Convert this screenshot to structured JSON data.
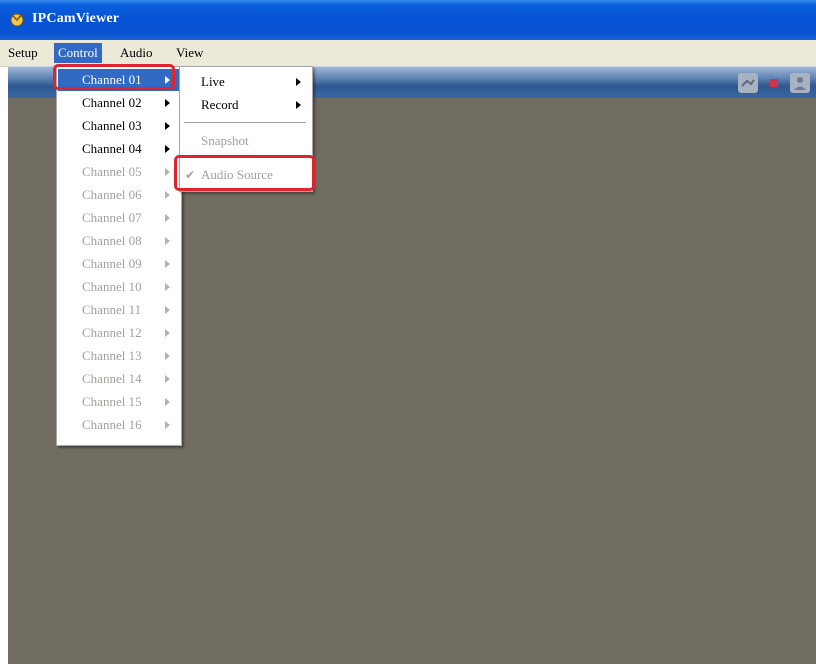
{
  "window": {
    "title": "IPCamViewer"
  },
  "menubar": {
    "items": [
      {
        "label": "Setup"
      },
      {
        "label": "Control"
      },
      {
        "label": "Audio"
      },
      {
        "label": "View"
      }
    ]
  },
  "control_menu": {
    "channels": [
      {
        "label": "Channel 01",
        "enabled": true,
        "selected": true
      },
      {
        "label": "Channel 02",
        "enabled": true
      },
      {
        "label": "Channel 03",
        "enabled": true
      },
      {
        "label": "Channel 04",
        "enabled": true
      },
      {
        "label": "Channel 05",
        "enabled": false
      },
      {
        "label": "Channel 06",
        "enabled": false
      },
      {
        "label": "Channel 07",
        "enabled": false
      },
      {
        "label": "Channel 08",
        "enabled": false
      },
      {
        "label": "Channel 09",
        "enabled": false
      },
      {
        "label": "Channel 10",
        "enabled": false
      },
      {
        "label": "Channel 11",
        "enabled": false
      },
      {
        "label": "Channel 12",
        "enabled": false
      },
      {
        "label": "Channel 13",
        "enabled": false
      },
      {
        "label": "Channel 14",
        "enabled": false
      },
      {
        "label": "Channel 15",
        "enabled": false
      },
      {
        "label": "Channel 16",
        "enabled": false
      }
    ]
  },
  "channel_submenu": {
    "live": "Live",
    "record": "Record",
    "snapshot": "Snapshot",
    "audio_source": "Audio Source",
    "audio_source_checked": true
  },
  "toolbar": {
    "icons": [
      "mic-icon",
      "stop-icon",
      "user-icon"
    ]
  },
  "colors": {
    "titlebar": "#0552d4",
    "menu_highlight": "#316ac5",
    "viewport": "#716c62",
    "annotation_red": "#e0242d"
  }
}
